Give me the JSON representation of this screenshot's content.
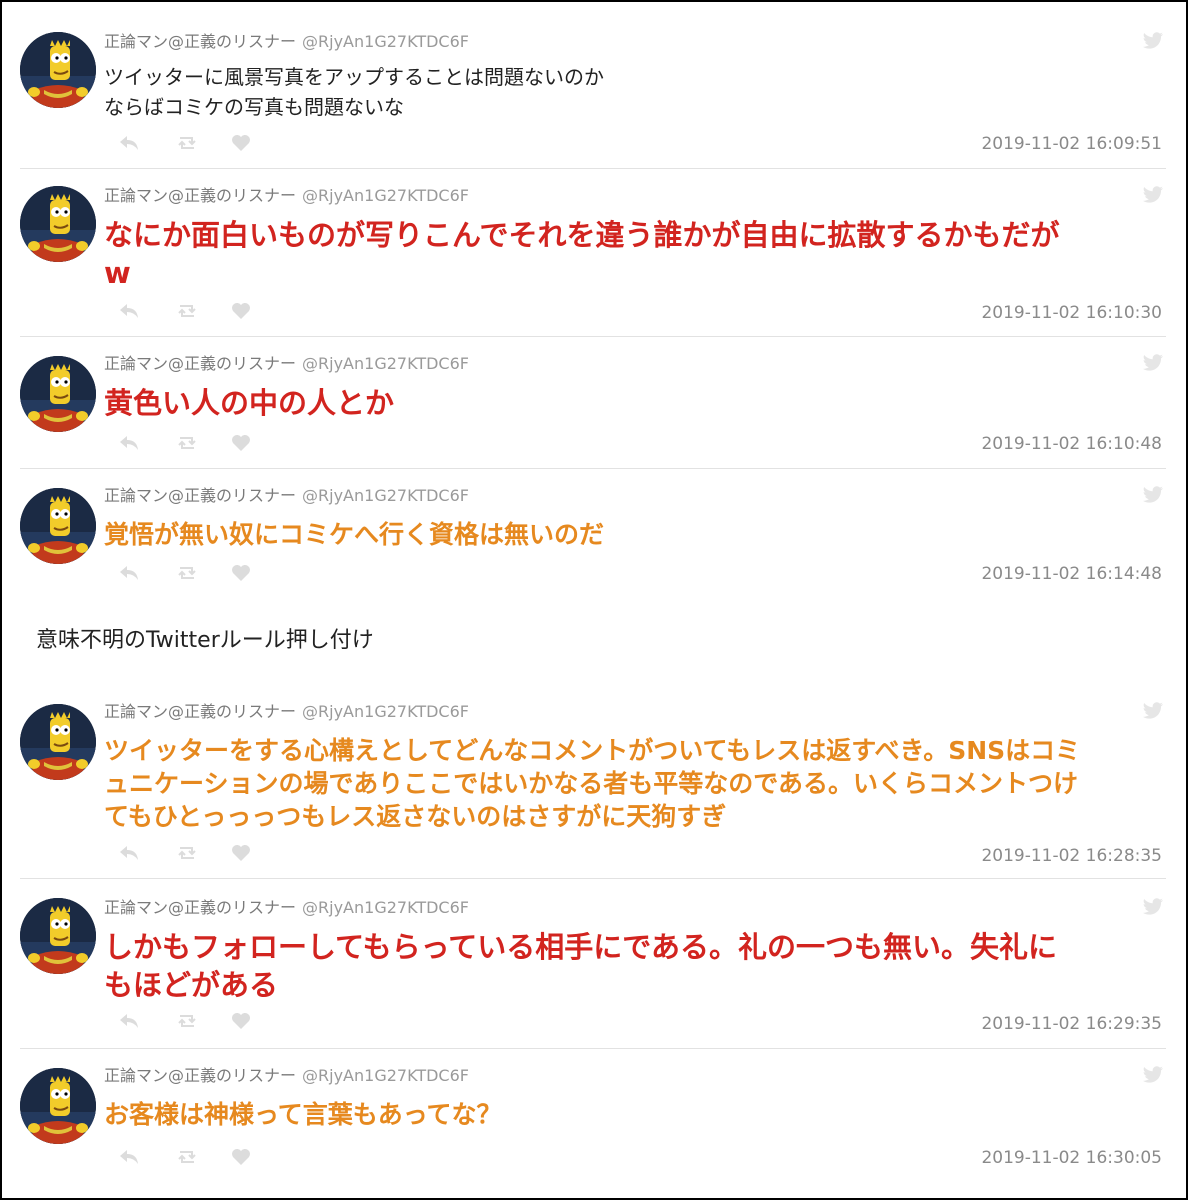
{
  "user": {
    "name": "正論マン@正義のリスナー",
    "handle": "@RjyAn1G27KTDC6F"
  },
  "icons": [
    "reply-icon",
    "retweet-icon",
    "like-icon",
    "twitter-bird-icon"
  ],
  "colors": {
    "red": "#d2241f",
    "orange": "#e6891f",
    "meta": "#8a8a8a"
  },
  "tweets": [
    {
      "lines": [
        "ツイッターに風景写真をアップすることは問題ないのか",
        "ならばコミケの写真も問題ないな"
      ],
      "style": "normal",
      "timestamp": "2019-11-02 16:09:51"
    },
    {
      "lines": [
        "なにか面白いものが写りこんでそれを違う誰かが自由に拡散するかもだが",
        "w"
      ],
      "style": "red",
      "timestamp": "2019-11-02 16:10:30"
    },
    {
      "lines": [
        "黄色い人の中の人とか"
      ],
      "style": "red",
      "timestamp": "2019-11-02 16:10:48"
    },
    {
      "lines": [
        "覚悟が無い奴にコミケへ行く資格は無いのだ"
      ],
      "style": "orange",
      "timestamp": "2019-11-02 16:14:48"
    },
    {
      "lines": [
        "ツイッターをする心構えとしてどんなコメントがついてもレスは返すべき。SNSはコミ",
        "ュニケーションの場でありここではいかなる者も平等なのである。いくらコメントつけ",
        "てもひとっっっつもレス返さないのはさすがに天狗すぎ"
      ],
      "style": "orange",
      "timestamp": "2019-11-02 16:28:35"
    },
    {
      "lines": [
        "しかもフォローしてもらっている相手にである。礼の一つも無い。失礼に",
        "もほどがある"
      ],
      "style": "red",
      "timestamp": "2019-11-02 16:29:35"
    },
    {
      "lines": [
        "お客様は神様って言葉もあってな？"
      ],
      "style": "orange",
      "timestamp": "2019-11-02 16:30:05"
    }
  ],
  "comment": "意味不明のTwitterルール押し付け"
}
